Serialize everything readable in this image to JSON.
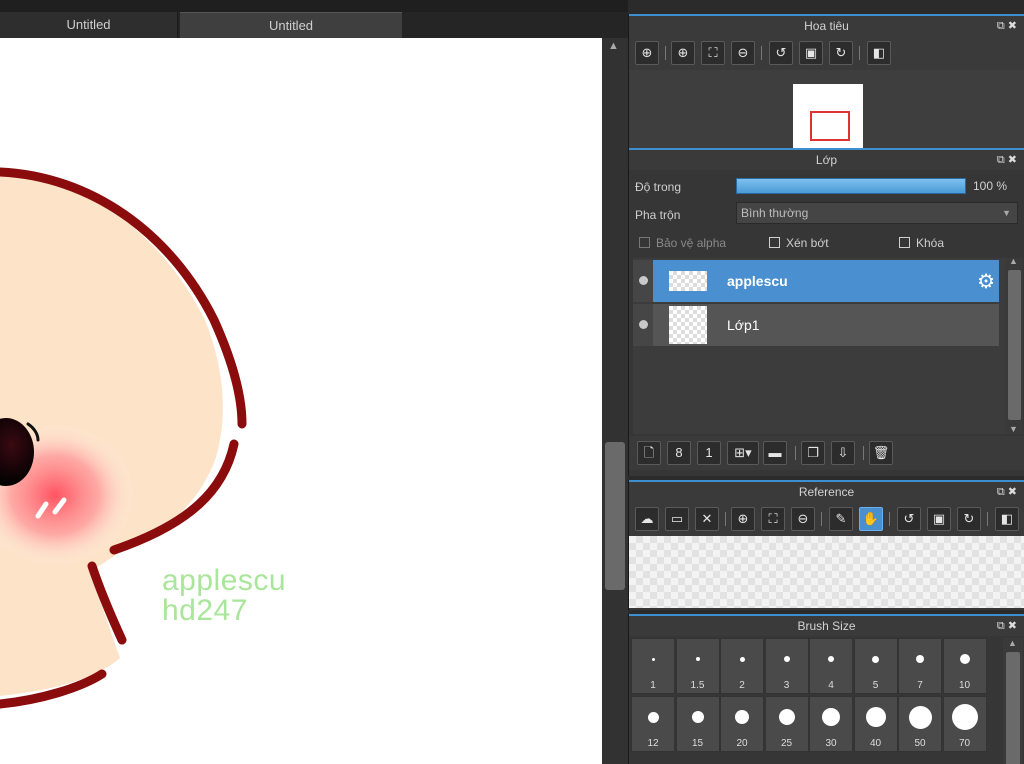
{
  "tabs": [
    {
      "label": "Untitled"
    },
    {
      "label": "Untitled"
    }
  ],
  "canvas": {
    "watermark_line1": "applescu",
    "watermark_line2": "hd247"
  },
  "navigator": {
    "title": "Hoa tiêu"
  },
  "layers_panel": {
    "title": "Lớp",
    "opacity_label": "Độ trong",
    "opacity_value": "100 %",
    "opacity": 1.0,
    "blend_label": "Pha trộn",
    "blend_value": "Bình thường",
    "protect_alpha": "Bảo vệ alpha",
    "clipping": "Xén bớt",
    "lock": "Khóa",
    "layers": [
      {
        "name": "applescu",
        "selected": true
      },
      {
        "name": "Lớp1",
        "selected": false
      }
    ]
  },
  "reference": {
    "title": "Reference"
  },
  "brush_size": {
    "title": "Brush Size",
    "sizes": [
      "1",
      "1.5",
      "2",
      "3",
      "4",
      "5",
      "7",
      "10",
      "12",
      "15",
      "20",
      "25",
      "30",
      "40",
      "50",
      "70"
    ]
  },
  "colors": {
    "accent": "#3d8fd0",
    "selected_layer": "#4a90d0",
    "outline": "#8b0000",
    "skin": "#fde3c8",
    "watermark": "#a9e59a"
  }
}
